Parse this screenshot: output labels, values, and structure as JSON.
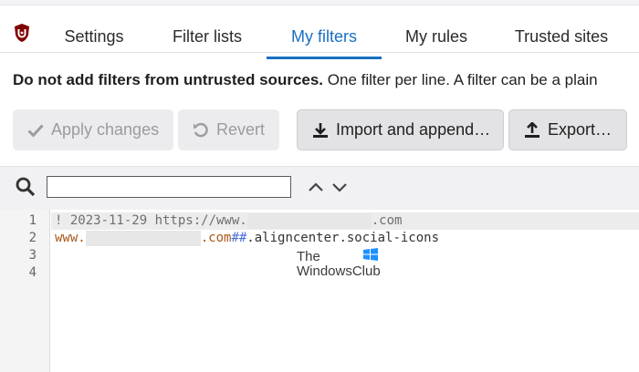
{
  "tabs": [
    {
      "label": "Settings",
      "active": false
    },
    {
      "label": "Filter lists",
      "active": false
    },
    {
      "label": "My filters",
      "active": true
    },
    {
      "label": "My rules",
      "active": false
    },
    {
      "label": "Trusted sites",
      "active": false
    }
  ],
  "notice": {
    "bold": "Do not add filters from untrusted sources.",
    "text": " One filter per line. A filter can be a plain"
  },
  "buttons": {
    "apply": "Apply changes",
    "revert": "Revert",
    "import": "Import and append…",
    "export": "Export…"
  },
  "search": {
    "value": "",
    "placeholder": ""
  },
  "editor": {
    "line_numbers": [
      "1",
      "2",
      "3",
      "4"
    ],
    "line1_prefix": "! 2023-11-29 https://www.",
    "line1_suffix": ".com",
    "line2_prefix": "www.",
    "line2_domain_end": ".com",
    "line2_sep": "##",
    "line2_selector": ".aligncenter.social-icons"
  },
  "watermark": {
    "line1": "The",
    "line2": "WindowsClub"
  },
  "colors": {
    "accent": "#1a6fc2",
    "logo": "#800000"
  },
  "icons": [
    "ublock-logo-icon",
    "checkmark-icon",
    "revert-icon",
    "import-icon",
    "export-icon",
    "search-icon",
    "chevron-up-icon",
    "chevron-down-icon"
  ]
}
